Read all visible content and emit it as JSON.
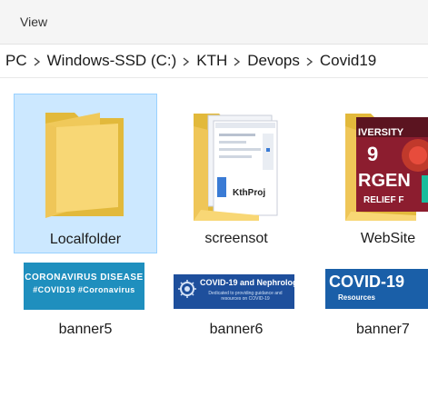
{
  "ribbon": {
    "view_label": "View"
  },
  "breadcrumb": [
    "PC",
    "Windows-SSD (C:)",
    "KTH",
    "Devops",
    "Covid19"
  ],
  "items": [
    {
      "name": "Localfolder",
      "type": "folder",
      "selected": true
    },
    {
      "name": "screensot",
      "type": "folder",
      "selected": false
    },
    {
      "name": "WebSite",
      "type": "folder",
      "selected": false
    },
    {
      "name": "banner5",
      "type": "image",
      "selected": false
    },
    {
      "name": "banner6",
      "type": "image",
      "selected": false
    },
    {
      "name": "banner7",
      "type": "image",
      "selected": false
    }
  ],
  "thumbnails": {
    "screensot_preview": {
      "title": "KthProj"
    },
    "website_preview": {
      "text_lines": [
        "IVERSITY",
        "9",
        "RGEN",
        "RELIEF F"
      ]
    },
    "banner5": {
      "line1": "CORONAVIRUS DISEASE",
      "line2": "#COVID19 #Coronavirus"
    },
    "banner6": {
      "title": "COVID-19 and Nephrology",
      "subtitle": "Dedicated to providing guidance and resources on COVID-19"
    },
    "banner7": {
      "title": "COVID-19",
      "subtitle": "Resources"
    }
  },
  "colors": {
    "selection_bg": "#cce8ff",
    "selection_border": "#99d1ff",
    "folder_yellow": "#f8d775",
    "folder_dark": "#e2b93b"
  },
  "icons": {
    "separator": "chevron-right-icon",
    "folder": "folder-icon"
  }
}
